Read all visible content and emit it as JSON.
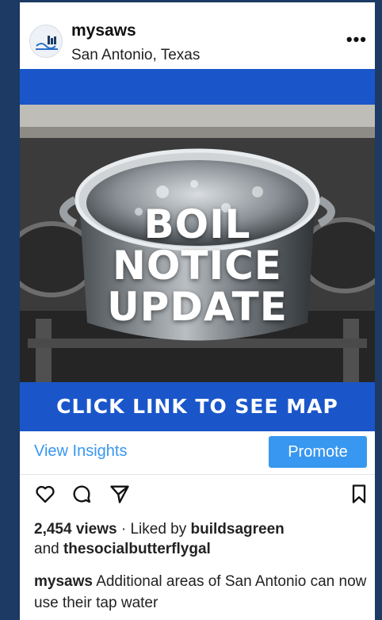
{
  "post": {
    "account": "mysaws",
    "location": "San Antonio, Texas",
    "more_icon": "more-horizontal-icon"
  },
  "media": {
    "headline_lines": [
      "BOIL",
      "NOTICE",
      "UPDATE"
    ],
    "cta": "CLICK LINK TO SEE MAP"
  },
  "insights": {
    "view_label": "View Insights",
    "promote_label": "Promote"
  },
  "actions": {
    "icons": [
      "heart-icon",
      "comment-icon",
      "share-icon",
      "bookmark-icon"
    ]
  },
  "stats": {
    "views": "2,454 views",
    "separator": " · Liked by ",
    "liker1": "buildsagreen",
    "and": "and",
    "liker2": "thesocialbutterflygal"
  },
  "caption": {
    "username": "mysaws",
    "text": "Additional areas of San Antonio can now use their tap water"
  },
  "colors": {
    "background": "#1c3a63",
    "brand_blue": "#1a56c9",
    "link_blue": "#3897f0"
  }
}
